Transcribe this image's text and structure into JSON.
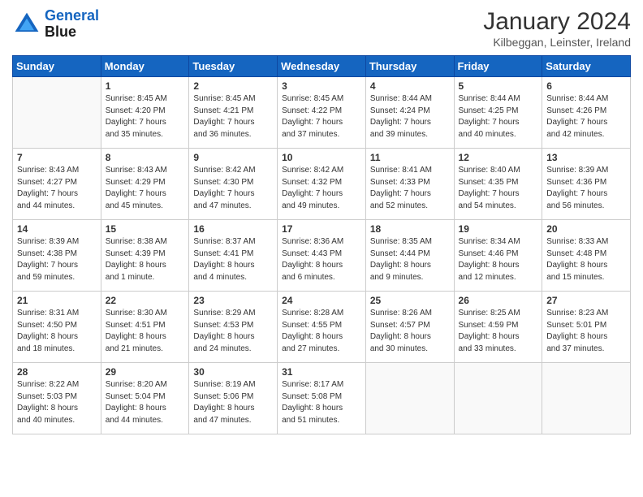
{
  "header": {
    "logo_line1": "General",
    "logo_line2": "Blue",
    "month_title": "January 2024",
    "subtitle": "Kilbeggan, Leinster, Ireland"
  },
  "columns": [
    "Sunday",
    "Monday",
    "Tuesday",
    "Wednesday",
    "Thursday",
    "Friday",
    "Saturday"
  ],
  "weeks": [
    [
      {
        "day": "",
        "info": ""
      },
      {
        "day": "1",
        "info": "Sunrise: 8:45 AM\nSunset: 4:20 PM\nDaylight: 7 hours\nand 35 minutes."
      },
      {
        "day": "2",
        "info": "Sunrise: 8:45 AM\nSunset: 4:21 PM\nDaylight: 7 hours\nand 36 minutes."
      },
      {
        "day": "3",
        "info": "Sunrise: 8:45 AM\nSunset: 4:22 PM\nDaylight: 7 hours\nand 37 minutes."
      },
      {
        "day": "4",
        "info": "Sunrise: 8:44 AM\nSunset: 4:24 PM\nDaylight: 7 hours\nand 39 minutes."
      },
      {
        "day": "5",
        "info": "Sunrise: 8:44 AM\nSunset: 4:25 PM\nDaylight: 7 hours\nand 40 minutes."
      },
      {
        "day": "6",
        "info": "Sunrise: 8:44 AM\nSunset: 4:26 PM\nDaylight: 7 hours\nand 42 minutes."
      }
    ],
    [
      {
        "day": "7",
        "info": "Sunrise: 8:43 AM\nSunset: 4:27 PM\nDaylight: 7 hours\nand 44 minutes."
      },
      {
        "day": "8",
        "info": "Sunrise: 8:43 AM\nSunset: 4:29 PM\nDaylight: 7 hours\nand 45 minutes."
      },
      {
        "day": "9",
        "info": "Sunrise: 8:42 AM\nSunset: 4:30 PM\nDaylight: 7 hours\nand 47 minutes."
      },
      {
        "day": "10",
        "info": "Sunrise: 8:42 AM\nSunset: 4:32 PM\nDaylight: 7 hours\nand 49 minutes."
      },
      {
        "day": "11",
        "info": "Sunrise: 8:41 AM\nSunset: 4:33 PM\nDaylight: 7 hours\nand 52 minutes."
      },
      {
        "day": "12",
        "info": "Sunrise: 8:40 AM\nSunset: 4:35 PM\nDaylight: 7 hours\nand 54 minutes."
      },
      {
        "day": "13",
        "info": "Sunrise: 8:39 AM\nSunset: 4:36 PM\nDaylight: 7 hours\nand 56 minutes."
      }
    ],
    [
      {
        "day": "14",
        "info": "Sunrise: 8:39 AM\nSunset: 4:38 PM\nDaylight: 7 hours\nand 59 minutes."
      },
      {
        "day": "15",
        "info": "Sunrise: 8:38 AM\nSunset: 4:39 PM\nDaylight: 8 hours\nand 1 minute."
      },
      {
        "day": "16",
        "info": "Sunrise: 8:37 AM\nSunset: 4:41 PM\nDaylight: 8 hours\nand 4 minutes."
      },
      {
        "day": "17",
        "info": "Sunrise: 8:36 AM\nSunset: 4:43 PM\nDaylight: 8 hours\nand 6 minutes."
      },
      {
        "day": "18",
        "info": "Sunrise: 8:35 AM\nSunset: 4:44 PM\nDaylight: 8 hours\nand 9 minutes."
      },
      {
        "day": "19",
        "info": "Sunrise: 8:34 AM\nSunset: 4:46 PM\nDaylight: 8 hours\nand 12 minutes."
      },
      {
        "day": "20",
        "info": "Sunrise: 8:33 AM\nSunset: 4:48 PM\nDaylight: 8 hours\nand 15 minutes."
      }
    ],
    [
      {
        "day": "21",
        "info": "Sunrise: 8:31 AM\nSunset: 4:50 PM\nDaylight: 8 hours\nand 18 minutes."
      },
      {
        "day": "22",
        "info": "Sunrise: 8:30 AM\nSunset: 4:51 PM\nDaylight: 8 hours\nand 21 minutes."
      },
      {
        "day": "23",
        "info": "Sunrise: 8:29 AM\nSunset: 4:53 PM\nDaylight: 8 hours\nand 24 minutes."
      },
      {
        "day": "24",
        "info": "Sunrise: 8:28 AM\nSunset: 4:55 PM\nDaylight: 8 hours\nand 27 minutes."
      },
      {
        "day": "25",
        "info": "Sunrise: 8:26 AM\nSunset: 4:57 PM\nDaylight: 8 hours\nand 30 minutes."
      },
      {
        "day": "26",
        "info": "Sunrise: 8:25 AM\nSunset: 4:59 PM\nDaylight: 8 hours\nand 33 minutes."
      },
      {
        "day": "27",
        "info": "Sunrise: 8:23 AM\nSunset: 5:01 PM\nDaylight: 8 hours\nand 37 minutes."
      }
    ],
    [
      {
        "day": "28",
        "info": "Sunrise: 8:22 AM\nSunset: 5:03 PM\nDaylight: 8 hours\nand 40 minutes."
      },
      {
        "day": "29",
        "info": "Sunrise: 8:20 AM\nSunset: 5:04 PM\nDaylight: 8 hours\nand 44 minutes."
      },
      {
        "day": "30",
        "info": "Sunrise: 8:19 AM\nSunset: 5:06 PM\nDaylight: 8 hours\nand 47 minutes."
      },
      {
        "day": "31",
        "info": "Sunrise: 8:17 AM\nSunset: 5:08 PM\nDaylight: 8 hours\nand 51 minutes."
      },
      {
        "day": "",
        "info": ""
      },
      {
        "day": "",
        "info": ""
      },
      {
        "day": "",
        "info": ""
      }
    ]
  ]
}
